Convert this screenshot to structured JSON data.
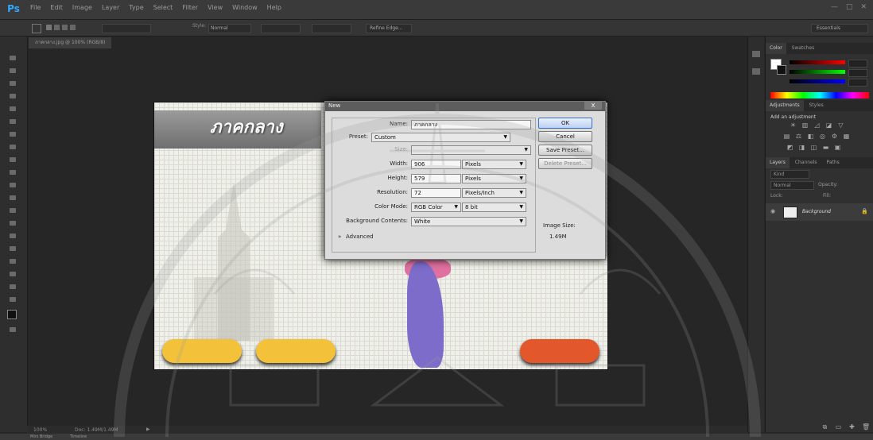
{
  "app": {
    "logo": "Ps"
  },
  "menubar": {
    "items": [
      "File",
      "Edit",
      "Image",
      "Layer",
      "Type",
      "Select",
      "Filter",
      "View",
      "Window",
      "Help"
    ],
    "controls": [
      "—",
      "□",
      "✕"
    ]
  },
  "options": {
    "style_label": "Style:",
    "style_value": "Normal",
    "refine_edge": "Refine Edge...",
    "workspace": "Essentials"
  },
  "document": {
    "tab_label": "ภาคกลาง.jpg @ 100% (RGB/8)"
  },
  "canvas": {
    "title_thai": "ภาคกลาง",
    "colors": {
      "pill_yellow": "#f4c23a",
      "pill_orange": "#e2582c"
    }
  },
  "dialog": {
    "title": "New",
    "close": "X",
    "name_label": "Name:",
    "name_value": "ภาคกลาง",
    "preset_label": "Preset:",
    "preset_value": "Custom",
    "size_label": "Size:",
    "width_label": "Width:",
    "width_value": "906",
    "width_unit": "Pixels",
    "height_label": "Height:",
    "height_value": "579",
    "height_unit": "Pixels",
    "resolution_label": "Resolution:",
    "resolution_value": "72",
    "resolution_unit": "Pixels/Inch",
    "color_mode_label": "Color Mode:",
    "color_mode_value": "RGB Color",
    "bit_depth": "8 bit",
    "background_label": "Background Contents:",
    "background_value": "White",
    "advanced_label": "Advanced",
    "ok": "OK",
    "cancel": "Cancel",
    "save_preset": "Save Preset...",
    "delete_preset": "Delete Preset...",
    "image_size_label": "Image Size:",
    "image_size_value": "1.49M"
  },
  "panels": {
    "color_tabs": [
      "Color",
      "Swatches"
    ],
    "adjust_tabs": [
      "Adjustments",
      "Styles"
    ],
    "adjust_title": "Add an adjustment",
    "layer_tabs": [
      "Layers",
      "Channels",
      "Paths"
    ],
    "kind_label": "Kind",
    "blend_mode": "Normal",
    "opacity_label": "Opacity:",
    "lock_label": "Lock:",
    "fill_label": "Fill:",
    "layer_name": "Background"
  },
  "status": {
    "zoom": "100%",
    "doc_info": "Doc: 1.49M/1.49M",
    "mini_bridge": "Mini Bridge",
    "timeline": "Timeline"
  }
}
